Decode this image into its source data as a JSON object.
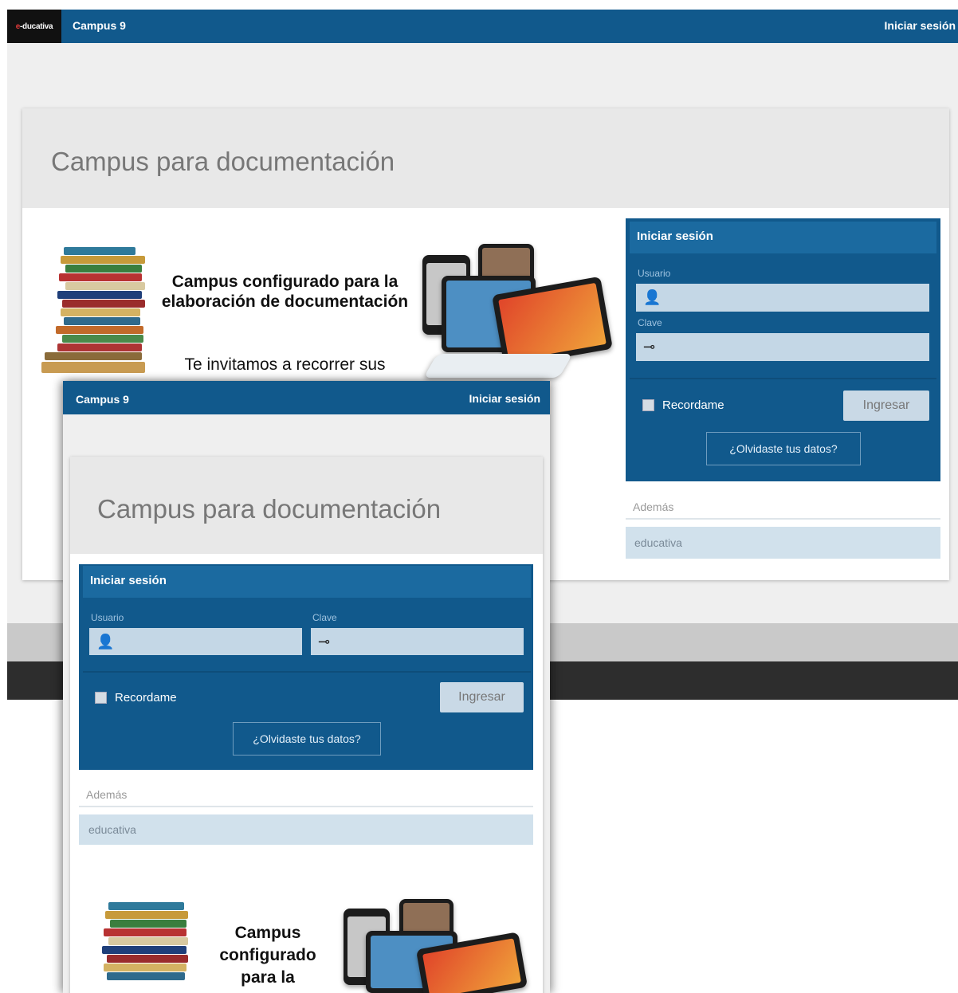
{
  "desktop": {
    "logo": {
      "prefix": "e",
      "rest": "-ducativa"
    },
    "brand": "Campus 9",
    "login_link": "Iniciar sesión",
    "page_title": "Campus para documentación",
    "promo": {
      "heading": "Campus configurado para la elaboración de documentación",
      "subtext": "Te invitamos a recorrer sus"
    },
    "login": {
      "title": "Iniciar sesión",
      "user_label": "Usuario",
      "pass_label": "Clave",
      "remember": "Recordame",
      "submit": "Ingresar",
      "forgot": "¿Olvidaste tus datos?"
    },
    "extras": {
      "heading": "Además",
      "item": "educativa"
    }
  },
  "mobile": {
    "brand": "Campus 9",
    "login_link": "Iniciar sesión",
    "page_title": "Campus para documentación",
    "login": {
      "title": "Iniciar sesión",
      "user_label": "Usuario",
      "pass_label": "Clave",
      "remember": "Recordame",
      "submit": "Ingresar",
      "forgot": "¿Olvidaste tus datos?"
    },
    "extras": {
      "heading": "Además",
      "item": "educativa"
    },
    "promo": {
      "line1": "Campus",
      "line2": "configurado",
      "line3": "para la"
    }
  },
  "icons": {
    "user": "user-icon",
    "key": "key-icon"
  },
  "colors": {
    "brand_blue": "#11598c",
    "panel_head": "#1b6aa0",
    "field_bg": "#c4d7e6",
    "page_bg": "#efefef"
  }
}
